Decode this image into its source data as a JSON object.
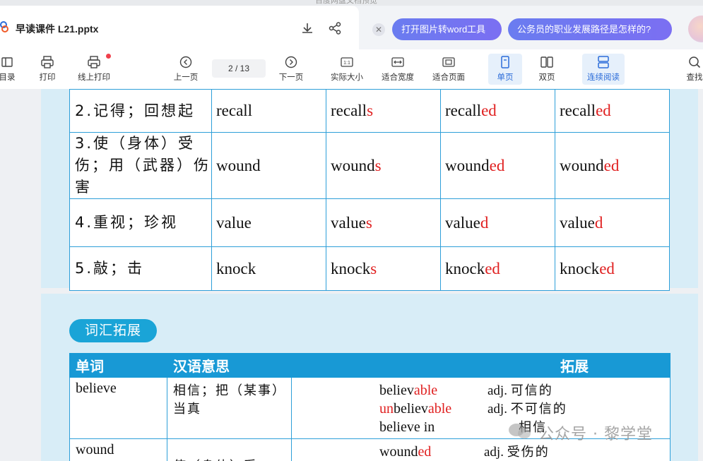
{
  "app_title": "百度网盘文档预览",
  "file": {
    "name": "早读课件 L21.pptx"
  },
  "tips": {
    "pill1": "打开图片转word工具",
    "pill2": "公务员的职业发展路径是怎样的?"
  },
  "toolbar": {
    "catalog": "目录",
    "print": "打印",
    "online_print": "线上打印",
    "prev": "上一页",
    "page_current": "2",
    "page_sep": "/",
    "page_total": "13",
    "next": "下一页",
    "actual_size": "实际大小",
    "fit_width": "适合宽度",
    "fit_page": "适合页面",
    "single": "单页",
    "double": "双页",
    "continuous": "连续阅读",
    "find": "查找",
    "actual_icon_text": "1:1"
  },
  "forms_rows": [
    {
      "cn": "2.记得；回想起",
      "base": "recall",
      "s": [
        "recall",
        "s"
      ],
      "past": [
        "recall",
        "ed"
      ],
      "pp": [
        "recall",
        "ed"
      ]
    },
    {
      "cn": "3.使（身体）受伤；用（武器）伤害",
      "base": "wound",
      "s": [
        "wound",
        "s"
      ],
      "past": [
        "wound",
        "ed"
      ],
      "pp": [
        "wound",
        "ed"
      ]
    },
    {
      "cn": "4.重视；珍视",
      "base": "value",
      "s": [
        "value",
        "s"
      ],
      "past": [
        "value",
        "d"
      ],
      "pp": [
        "value",
        "d"
      ]
    },
    {
      "cn": "5.敲；击",
      "base": "knock",
      "s": [
        "knock",
        "s"
      ],
      "past": [
        "knock",
        "ed"
      ],
      "pp": [
        "knock",
        "ed"
      ]
    }
  ],
  "extension": {
    "tag": "词汇拓展",
    "headers": {
      "word": "单词",
      "meaning": "汉语意思",
      "extend": "拓展"
    },
    "rows": [
      {
        "word": "believe",
        "meaning": "相信；把（某事）当真",
        "items": [
          {
            "pre": "",
            "pre_red": "",
            "stem": "believ",
            "suffix": "able",
            "pos": "adj.",
            "cn": "可信的"
          },
          {
            "pre": "",
            "pre_red": "un",
            "stem": "believ",
            "suffix": "able",
            "pos": "adj.",
            "cn": "不可信的"
          },
          {
            "pre": "believe in",
            "pre_red": "",
            "stem": "",
            "suffix": "",
            "pos": "",
            "cn": "相信"
          }
        ]
      },
      {
        "word": "wound",
        "meaning": "使（身体）受",
        "items": [
          {
            "pre": "",
            "pre_red": "",
            "stem": "wound",
            "suffix": "ed",
            "pos": "adj.",
            "cn": "受伤的"
          }
        ]
      }
    ]
  },
  "watermark": "公众号 · 黎学堂"
}
